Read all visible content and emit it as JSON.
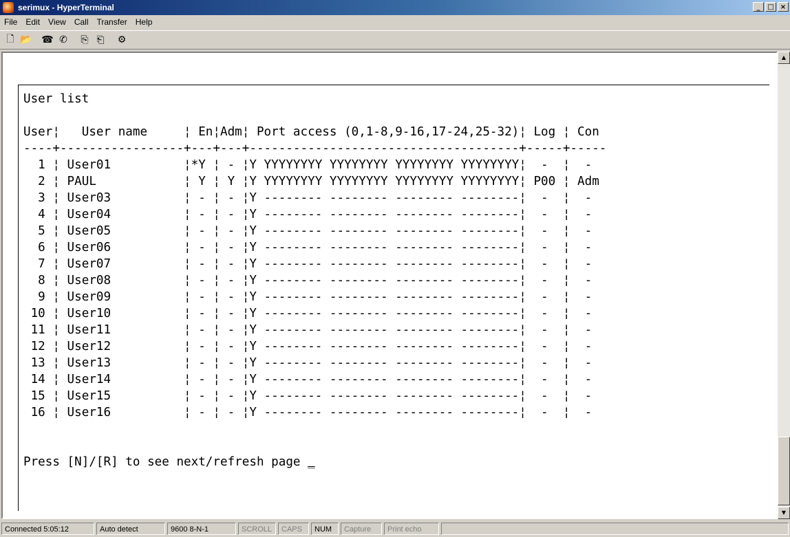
{
  "window": {
    "title": "serimux - HyperTerminal",
    "buttons": [
      "_",
      "□",
      "×"
    ]
  },
  "menu": [
    "File",
    "Edit",
    "View",
    "Call",
    "Transfer",
    "Help"
  ],
  "toolbar": [
    {
      "name": "new-icon",
      "glyph": "🗋"
    },
    {
      "name": "open-icon",
      "glyph": "📂"
    },
    {
      "name": "call-icon",
      "glyph": "☎"
    },
    {
      "name": "disconnect-icon",
      "glyph": "✆"
    },
    {
      "name": "send-icon",
      "glyph": "⎘"
    },
    {
      "name": "receive-icon",
      "glyph": "⎗"
    },
    {
      "name": "properties-icon",
      "glyph": "⚙"
    }
  ],
  "terminal": {
    "lines": [
      "User list",
      "",
      "User¦   User name     ¦ En¦Adm¦ Port access (0,1-8,9-16,17-24,25-32)¦ Log ¦ Con",
      "----+-----------------+---+---+-------------------------------------+-----+-----",
      "  1 ¦ User01          ¦*Y ¦ - ¦Y YYYYYYYY YYYYYYYY YYYYYYYY YYYYYYYY¦  -  ¦  -",
      "  2 ¦ PAUL            ¦ Y ¦ Y ¦Y YYYYYYYY YYYYYYYY YYYYYYYY YYYYYYYY¦ P00 ¦ Adm",
      "  3 ¦ User03          ¦ - ¦ - ¦Y -------- -------- -------- --------¦  -  ¦  -",
      "  4 ¦ User04          ¦ - ¦ - ¦Y -------- -------- -------- --------¦  -  ¦  -",
      "  5 ¦ User05          ¦ - ¦ - ¦Y -------- -------- -------- --------¦  -  ¦  -",
      "  6 ¦ User06          ¦ - ¦ - ¦Y -------- -------- -------- --------¦  -  ¦  -",
      "  7 ¦ User07          ¦ - ¦ - ¦Y -------- -------- -------- --------¦  -  ¦  -",
      "  8 ¦ User08          ¦ - ¦ - ¦Y -------- -------- -------- --------¦  -  ¦  -",
      "  9 ¦ User09          ¦ - ¦ - ¦Y -------- -------- -------- --------¦  -  ¦  -",
      " 10 ¦ User10          ¦ - ¦ - ¦Y -------- -------- -------- --------¦  -  ¦  -",
      " 11 ¦ User11          ¦ - ¦ - ¦Y -------- -------- -------- --------¦  -  ¦  -",
      " 12 ¦ User12          ¦ - ¦ - ¦Y -------- -------- -------- --------¦  -  ¦  -",
      " 13 ¦ User13          ¦ - ¦ - ¦Y -------- -------- -------- --------¦  -  ¦  -",
      " 14 ¦ User14          ¦ - ¦ - ¦Y -------- -------- -------- --------¦  -  ¦  -",
      " 15 ¦ User15          ¦ - ¦ - ¦Y -------- -------- -------- --------¦  -  ¦  -",
      " 16 ¦ User16          ¦ - ¦ - ¦Y -------- -------- -------- --------¦  -  ¦  -",
      "",
      ""
    ],
    "prompt": "Press [N]/[R] to see next/refresh page ",
    "cursor": "_"
  },
  "status": [
    {
      "text": "Connected 5:05:12",
      "dim": false
    },
    {
      "text": "Auto detect",
      "dim": false
    },
    {
      "text": "9600 8-N-1",
      "dim": false
    },
    {
      "text": "SCROLL",
      "dim": true
    },
    {
      "text": "CAPS",
      "dim": true
    },
    {
      "text": "NUM",
      "dim": false
    },
    {
      "text": "Capture",
      "dim": true
    },
    {
      "text": "Print echo",
      "dim": true
    }
  ]
}
